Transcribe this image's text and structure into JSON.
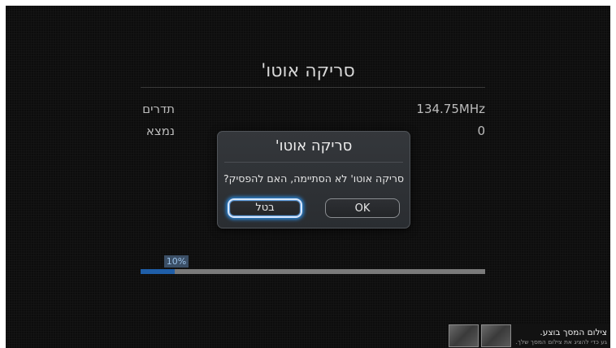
{
  "screen": {
    "title": "סריקה אוטו'",
    "rows": [
      {
        "label": "תדרים",
        "value": "134.75MHz"
      },
      {
        "label": "נמצא",
        "value": "0"
      }
    ],
    "progress": {
      "label": "10%",
      "value": 0.1
    }
  },
  "dialog": {
    "title": "סריקה אוטו'",
    "message": "סריקה אוטו' לא הסתיימה, האם להפסיק?",
    "cancel_label": "בטל",
    "ok_label": "OK"
  },
  "toast": {
    "title": "צילום המסך בוצע.",
    "subtitle": "גע כדי להציג את צילום המסך שלך."
  },
  "colors": {
    "background": "#0d0d0d",
    "accent": "#1f5ea8",
    "focus_glow": "#2a86d8"
  }
}
